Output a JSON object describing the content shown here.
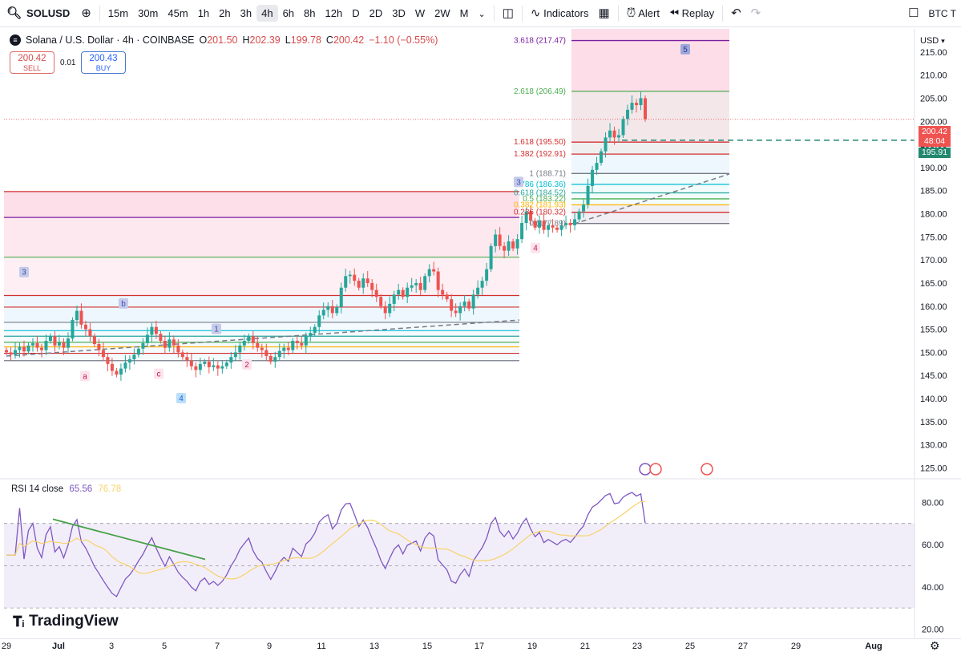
{
  "toolbar": {
    "symbol": "SOLUSD",
    "intervals": [
      "15m",
      "30m",
      "45m",
      "1h",
      "2h",
      "3h",
      "4h",
      "6h",
      "8h",
      "12h",
      "D",
      "2D",
      "3D",
      "W",
      "2W",
      "M"
    ],
    "active_interval": "4h",
    "indicators_label": "Indicators",
    "alert_label": "Alert",
    "replay_label": "Replay",
    "compare_label": "BTC T"
  },
  "header": {
    "title": "Solana / U.S. Dollar · 4h · COINBASE",
    "o_label": "O",
    "o": "201.50",
    "h_label": "H",
    "h": "202.39",
    "l_label": "L",
    "l": "199.78",
    "c_label": "C",
    "c": "200.42",
    "change": "−1.10 (−0.55%)"
  },
  "trade": {
    "sell_price": "200.42",
    "sell_label": "SELL",
    "spread": "0.01",
    "buy_price": "200.43",
    "buy_label": "BUY"
  },
  "price_axis": {
    "currency": "USD",
    "ticks": [
      "215.00",
      "210.00",
      "205.00",
      "200.00",
      "195.00",
      "190.00",
      "185.00",
      "180.00",
      "175.00",
      "170.00",
      "165.00",
      "160.00",
      "155.00",
      "150.00",
      "145.00",
      "140.00",
      "135.00",
      "130.00",
      "125.00"
    ],
    "last_price": "200.42",
    "countdown": "48:04",
    "line_price": "195.91"
  },
  "fib_levels": [
    {
      "ratio": "3.618",
      "price": "217.47",
      "color": "#7b1fa2"
    },
    {
      "ratio": "2.618",
      "price": "206.49",
      "color": "#4caf50"
    },
    {
      "ratio": "1.618",
      "price": "195.50",
      "color": "#d32f2f"
    },
    {
      "ratio": "1.382",
      "price": "192.91",
      "color": "#d32f2f"
    },
    {
      "ratio": "1",
      "price": "188.71",
      "color": "#787b86"
    },
    {
      "ratio": "0.786",
      "price": "186.36",
      "color": "#00bcd4"
    },
    {
      "ratio": "0.618",
      "price": "184.52",
      "color": "#26a69a"
    },
    {
      "ratio": "0.5",
      "price": "183.22",
      "color": "#4caf50"
    },
    {
      "ratio": "0.382",
      "price": "181.93",
      "color": "#ffb300"
    },
    {
      "ratio": "0.236",
      "price": "180.32",
      "color": "#d32f2f"
    },
    {
      "ratio": "0",
      "price": "177.89",
      "color": "#787b86"
    }
  ],
  "wave_labels": {
    "w3a": "3",
    "w3b": "3",
    "wa": "a",
    "wb": "b",
    "wc": "c",
    "w1": "1",
    "w2": "2",
    "w4a": "4",
    "w4b": "4",
    "w5": "5"
  },
  "rsi": {
    "label": "RSI 14 close",
    "value": "65.56",
    "ma_value": "76.78",
    "ticks": [
      "80.00",
      "60.00",
      "40.00",
      "20.00"
    ]
  },
  "x_axis": {
    "ticks": [
      "29",
      "Jul",
      "3",
      "5",
      "7",
      "9",
      "11",
      "13",
      "15",
      "17",
      "19",
      "21",
      "23",
      "25",
      "27",
      "29",
      "Aug"
    ]
  },
  "logo": "TradingView",
  "chart_data": {
    "type": "candlestick",
    "title": "Solana / U.S. Dollar · 4h · COINBASE",
    "ylim": [
      123,
      220
    ],
    "rsi_ylim": [
      16,
      90
    ],
    "last_close": 200.42,
    "close": [
      150.0,
      149.5,
      150.5,
      151.2,
      150.2,
      151.5,
      152.0,
      151.0,
      150.5,
      152.5,
      153.5,
      151.5,
      152.2,
      151.0,
      153.0,
      157.0,
      159.0,
      156.0,
      155.0,
      153.5,
      151.8,
      150.5,
      149.0,
      147.5,
      146.0,
      145.2,
      146.5,
      147.8,
      148.5,
      149.5,
      150.8,
      152.0,
      153.8,
      155.5,
      154.0,
      152.5,
      151.0,
      152.8,
      151.5,
      150.0,
      149.0,
      148.2,
      147.0,
      146.2,
      147.5,
      148.0,
      146.8,
      147.2,
      146.5,
      147.0,
      147.8,
      149.0,
      150.0,
      151.5,
      152.5,
      153.5,
      152.0,
      151.0,
      150.5,
      149.2,
      148.0,
      149.0,
      150.3,
      151.0,
      150.5,
      152.5,
      152.0,
      151.5,
      153.5,
      154.2,
      155.5,
      158.0,
      159.2,
      160.0,
      158.5,
      159.8,
      164.0,
      166.5,
      166.8,
      165.5,
      164.0,
      166.0,
      165.0,
      163.5,
      162.0,
      160.0,
      158.5,
      160.5,
      162.5,
      163.5,
      162.0,
      164.0,
      164.5,
      165.0,
      163.5,
      166.5,
      168.0,
      167.5,
      163.5,
      162.5,
      161.5,
      159.0,
      158.5,
      160.0,
      161.0,
      159.5,
      162.5,
      164.0,
      165.5,
      168.0,
      173.0,
      175.5,
      173.0,
      172.0,
      174.0,
      172.5,
      174.5,
      178.0,
      180.5,
      178.5,
      177.0,
      178.5,
      176.5,
      177.5,
      177.0,
      176.5,
      177.5,
      178.0,
      177.5,
      178.8,
      180.5,
      182.0,
      186.0,
      189.5,
      191.0,
      193.5,
      196.5,
      198.0,
      196.5,
      197.0,
      200.5,
      202.5,
      204.0,
      203.5,
      205.0,
      200.5
    ]
  }
}
